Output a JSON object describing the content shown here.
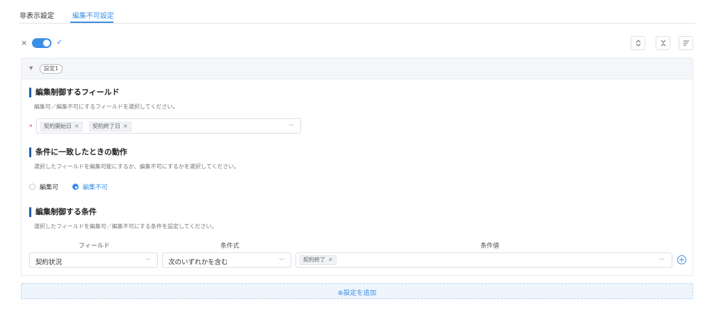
{
  "tabs": [
    {
      "label": "非表示設定",
      "active": false
    },
    {
      "label": "編集不可設定",
      "active": true
    }
  ],
  "toolbar": {
    "toggle_on": true,
    "toggle_off_mark": "×",
    "toggle_on_mark": "✓",
    "icons": [
      "expand-all-icon",
      "collapse-all-icon",
      "sort-icon"
    ]
  },
  "panel": {
    "name": "設定1",
    "field_section": {
      "title": "編集制御するフィールド",
      "description": "編集可／編集不可にするフィールドを選択してください。",
      "required_mark": "*",
      "selected_fields": [
        "契約開始日",
        "契約終了日"
      ]
    },
    "action_section": {
      "title": "条件に一致したときの動作",
      "description": "選択したフィールドを編集可能にするか、編集不可にするかを選択してください。",
      "options": [
        "編集可",
        "編集不可"
      ],
      "selected": "編集不可"
    },
    "condition_section": {
      "title": "編集制御する条件",
      "description": "選択したフィールドを編集可／編集不可にする条件を設定してください。",
      "headers": {
        "field": "フィールド",
        "operator": "条件式",
        "value": "条件値"
      },
      "row": {
        "field": "契約状況",
        "operator": "次のいずれかを含む",
        "values": [
          "契約終了"
        ]
      }
    }
  },
  "add_setting_label": "⊕設定を追加",
  "colors": {
    "accent": "#3a8ee6",
    "section_bar": "#1f5fa8",
    "required": "#e5484d"
  }
}
